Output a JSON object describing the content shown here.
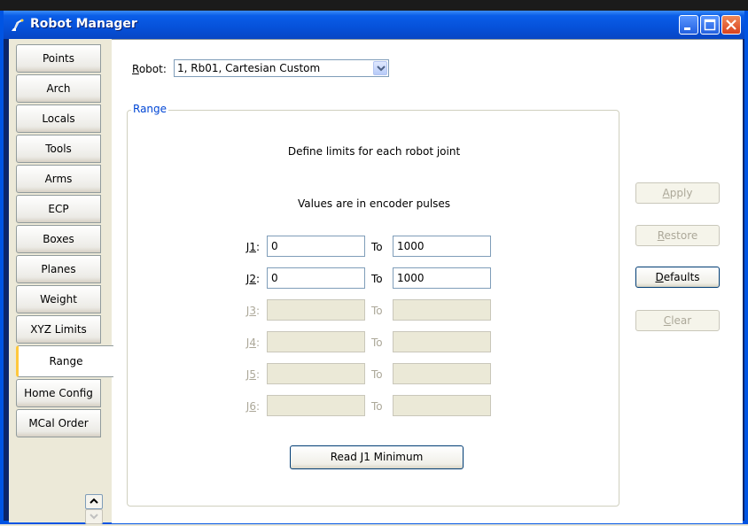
{
  "window": {
    "title": "Robot Manager"
  },
  "tabs": [
    {
      "label": "Points"
    },
    {
      "label": "Arch"
    },
    {
      "label": "Locals"
    },
    {
      "label": "Tools"
    },
    {
      "label": "Arms"
    },
    {
      "label": "ECP"
    },
    {
      "label": "Boxes"
    },
    {
      "label": "Planes"
    },
    {
      "label": "Weight"
    },
    {
      "label": "XYZ Limits"
    },
    {
      "label": "Range"
    },
    {
      "label": "Home Config"
    },
    {
      "label": "MCal Order"
    }
  ],
  "active_tab": "Range",
  "robot": {
    "label_prefix": "R",
    "label_rest": "obot:",
    "selected": "1, Rb01, Cartesian Custom"
  },
  "range": {
    "title": "Range",
    "info1": "Define limits for each robot joint",
    "info2": "Values are in encoder pulses",
    "to_label": "To",
    "joints": [
      {
        "pre": "J",
        "hot": "1",
        "post": ":",
        "from": "0",
        "to": "1000",
        "enabled": true
      },
      {
        "pre": "J",
        "hot": "2",
        "post": ":",
        "from": "0",
        "to": "1000",
        "enabled": true
      },
      {
        "pre": "J",
        "hot": "3",
        "post": ":",
        "from": "",
        "to": "",
        "enabled": false
      },
      {
        "pre": "J",
        "hot": "4",
        "post": ":",
        "from": "",
        "to": "",
        "enabled": false
      },
      {
        "pre": "J",
        "hot": "5",
        "post": ":",
        "from": "",
        "to": "",
        "enabled": false
      },
      {
        "pre": "J",
        "hot": "6",
        "post": ":",
        "from": "",
        "to": "",
        "enabled": false
      }
    ],
    "read_button": "Read J1 Minimum"
  },
  "buttons": {
    "apply": {
      "hot": "A",
      "rest": "pply",
      "enabled": false
    },
    "restore": {
      "hot": "R",
      "rest": "estore",
      "enabled": false
    },
    "defaults": {
      "hot": "D",
      "rest": "efaults",
      "enabled": true
    },
    "clear": {
      "hot": "C",
      "rest": "lear",
      "enabled": false
    }
  },
  "icons": [
    "robot-arm-icon",
    "minimize-icon",
    "maximize-icon",
    "close-icon",
    "chevron-down-icon",
    "scroll-up-icon",
    "scroll-down-icon"
  ],
  "colors": {
    "titlebar": "#0651d9",
    "group_title": "#0046d5",
    "active_tab_accent": "#ffc83c",
    "disabled_text": "#aca899"
  }
}
